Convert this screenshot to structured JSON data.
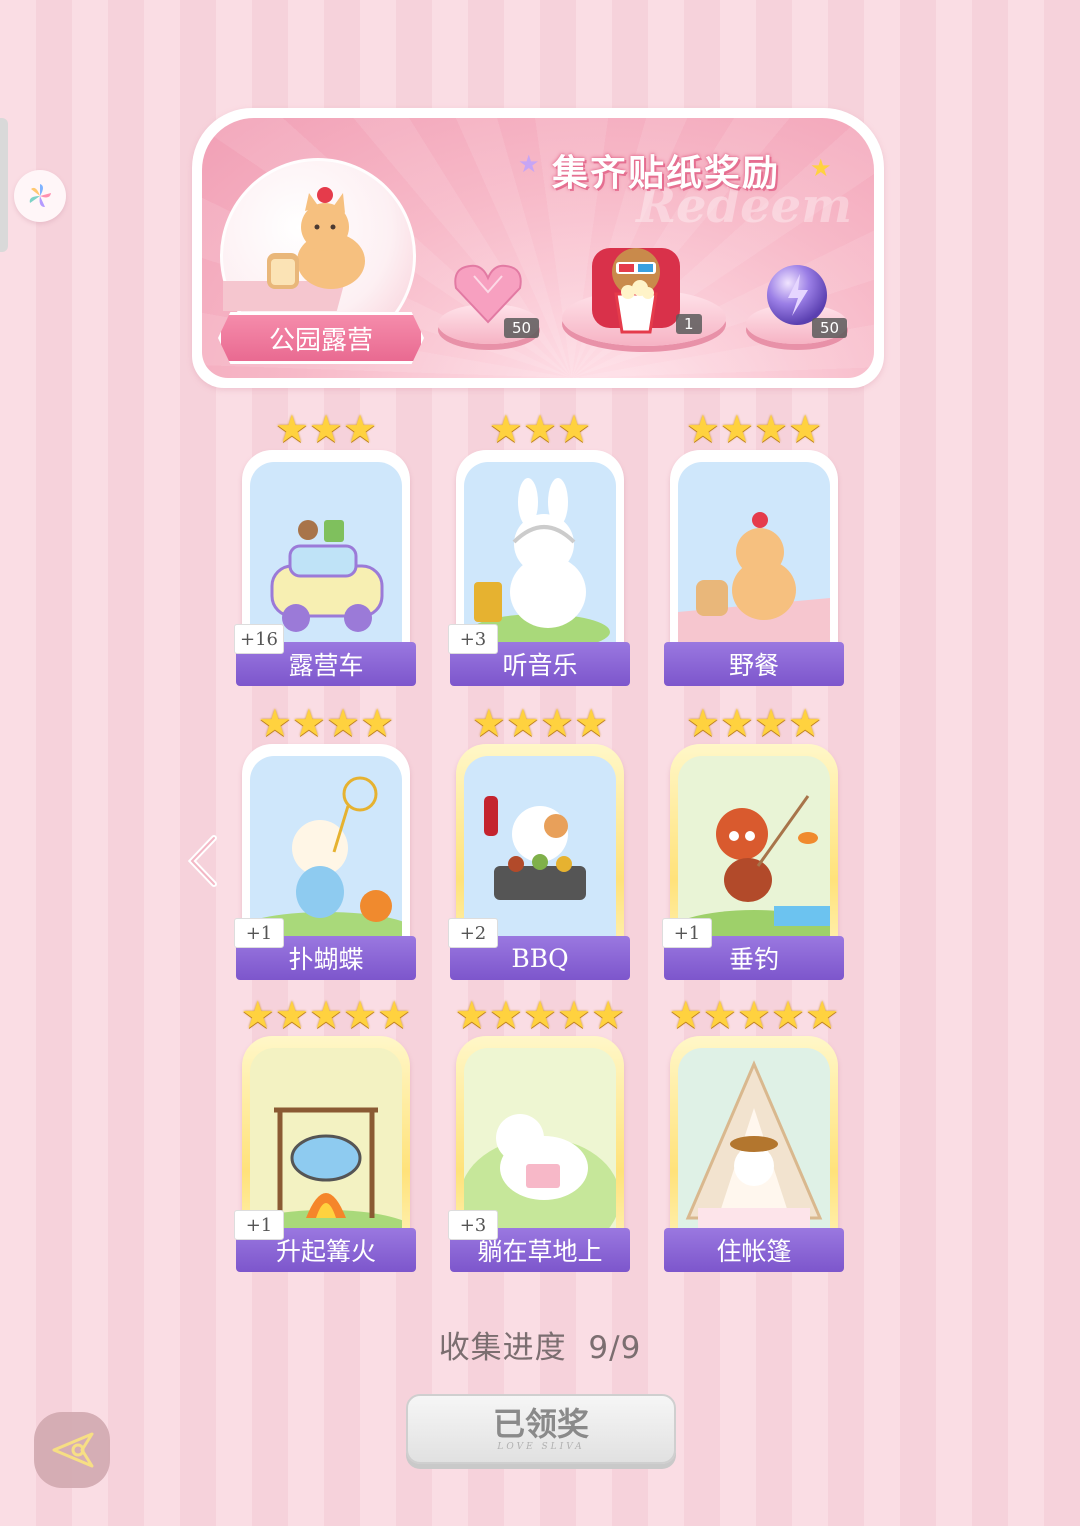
{
  "banner": {
    "title": "集齐贴纸奖励",
    "watermark": "Redeem",
    "set_name": "公园露营",
    "rewards": [
      {
        "icon": "pink-heart-gem-icon",
        "count": "50"
      },
      {
        "icon": "cinema-bear-popcorn-icon",
        "count": "1"
      },
      {
        "icon": "purple-energy-orb-icon",
        "count": "50"
      }
    ]
  },
  "cards": [
    {
      "name": "露营车",
      "bonus": "+16",
      "stars": 3,
      "tier": "normal",
      "icon": "camper-car-icon"
    },
    {
      "name": "听音乐",
      "bonus": "+3",
      "stars": 3,
      "tier": "normal",
      "icon": "bunny-headphones-icon"
    },
    {
      "name": "野餐",
      "bonus": "",
      "stars": 4,
      "tier": "normal",
      "icon": "cat-picnic-icon"
    },
    {
      "name": "扑蝴蝶",
      "bonus": "+1",
      "stars": 4,
      "tier": "normal",
      "icon": "bear-butterfly-net-icon"
    },
    {
      "name": "BBQ",
      "bonus": "+2",
      "stars": 4,
      "tier": "gold",
      "icon": "cat-bbq-grill-icon"
    },
    {
      "name": "垂钓",
      "bonus": "+1",
      "stars": 4,
      "tier": "gold",
      "icon": "red-panda-fishing-icon"
    },
    {
      "name": "升起篝火",
      "bonus": "+1",
      "stars": 5,
      "tier": "gold",
      "icon": "campfire-pot-icon"
    },
    {
      "name": "躺在草地上",
      "bonus": "+3",
      "stars": 5,
      "tier": "gold",
      "icon": "puppy-reading-grass-icon"
    },
    {
      "name": "住帐篷",
      "bonus": "",
      "stars": 5,
      "tier": "gold",
      "icon": "dog-tent-tea-icon"
    }
  ],
  "progress": {
    "label": "收集进度",
    "value": "9/9"
  },
  "claim_button": {
    "label": "已领奖",
    "sub": "LOVE SLIVA"
  },
  "colors": {
    "accent_purple": "#8a63d6",
    "pink": "#f19fb5",
    "star_gold": "#ffd23f"
  }
}
